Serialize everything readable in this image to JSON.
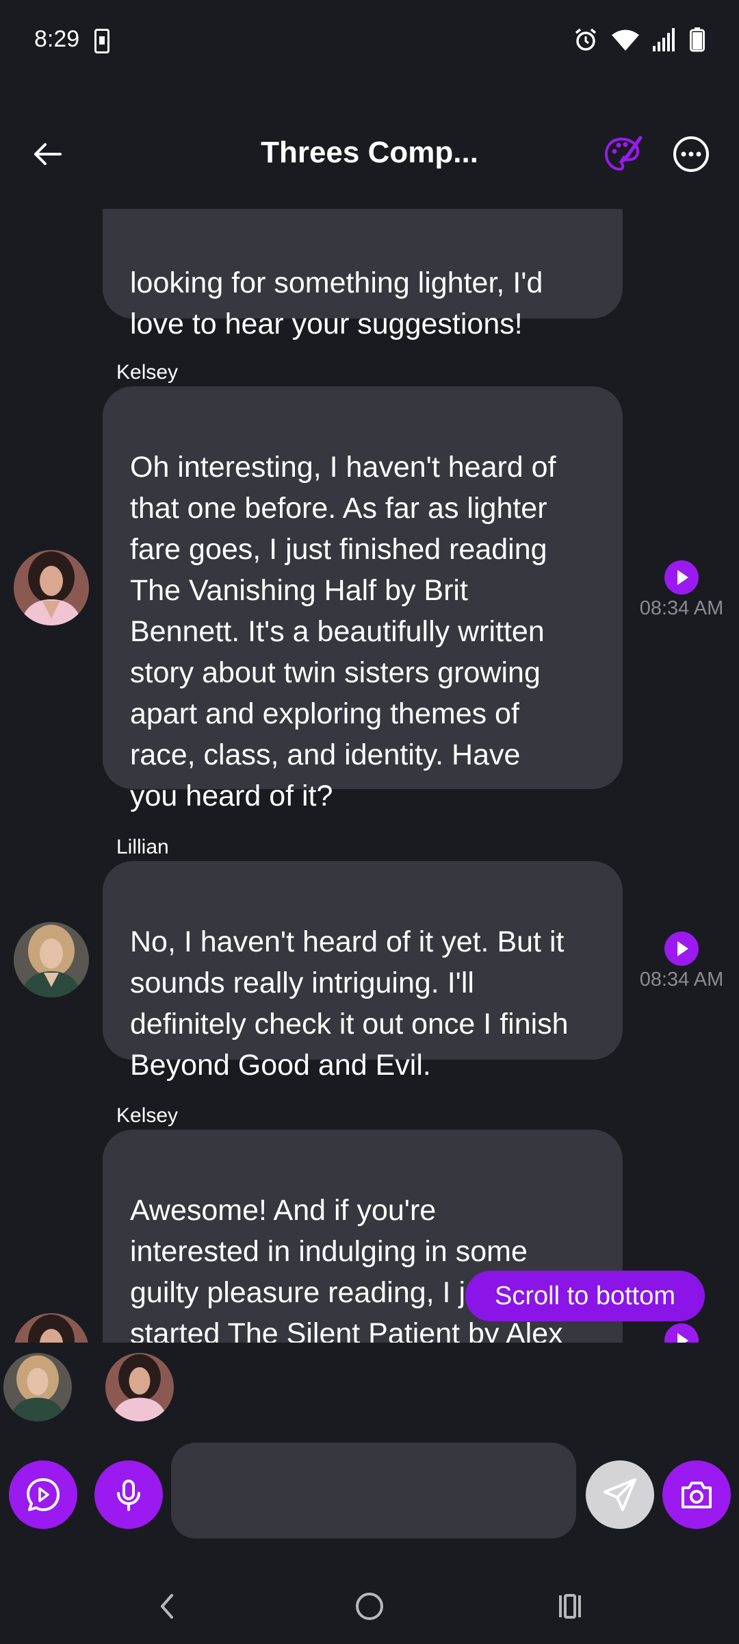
{
  "status_bar": {
    "time": "8:29"
  },
  "header": {
    "title": "Threes Comp...",
    "accent_color": "#9a1af0"
  },
  "messages": [
    {
      "sender": "",
      "text": "looking for something lighter, I'd\nlove to hear your suggestions!",
      "time": ""
    },
    {
      "sender": "Kelsey",
      "text": "Oh interesting, I haven't heard of\nthat one before. As far as lighter\nfare goes, I just finished reading\nThe Vanishing Half by Brit\nBennett. It's a beautifully written\nstory about twin sisters growing\napart and exploring themes of\nrace, class, and identity. Have\nyou heard of it?",
      "time": "08:34 AM"
    },
    {
      "sender": "Lillian",
      "text": "No, I haven't heard of it yet. But it\nsounds really intriguing. I'll\ndefinitely check it out once I finish\nBeyond Good and Evil.",
      "time": "08:34 AM"
    },
    {
      "sender": "Kelsey",
      "text": "Awesome! And if you're\ninterested in indulging in some\nguilty pleasure reading, I just\nstarted The Silent Patient by Alex\nMichaelides. It's a psychological",
      "time": ""
    }
  ],
  "scroll_to_bottom": "Scroll to bottom",
  "input": {
    "value": "",
    "placeholder": ""
  },
  "icons": {
    "back": "arrow-left-icon",
    "palette": "palette-icon",
    "more": "more-horizontal-icon",
    "play": "play-icon",
    "video": "play-message-icon",
    "mic": "mic-icon",
    "send": "send-icon",
    "camera": "camera-icon"
  }
}
